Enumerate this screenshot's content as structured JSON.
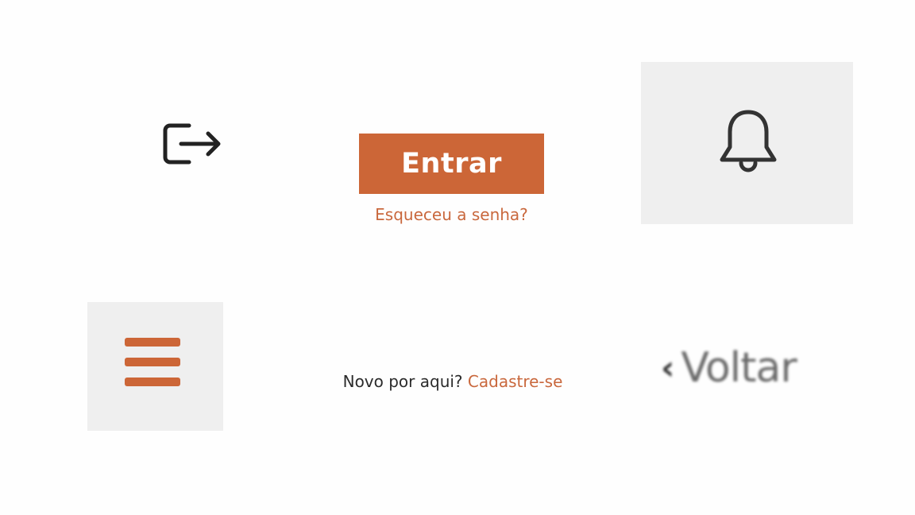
{
  "colors": {
    "accent": "#cc6637",
    "link": "#c9683d",
    "text": "#2b2b2b",
    "tile": "#efefef",
    "icon_stroke": "#222222"
  },
  "icons": {
    "logout": "logout-icon",
    "bell": "bell-icon",
    "menu": "hamburger-menu-icon",
    "back": "chevron-left-icon"
  },
  "login": {
    "enter_label": "Entrar",
    "forgot_label": "Esqueceu a senha?"
  },
  "signup": {
    "prompt": "Novo por aqui?",
    "link_label": "Cadastre-se"
  },
  "back": {
    "chevron": "‹",
    "label": "Voltar"
  }
}
